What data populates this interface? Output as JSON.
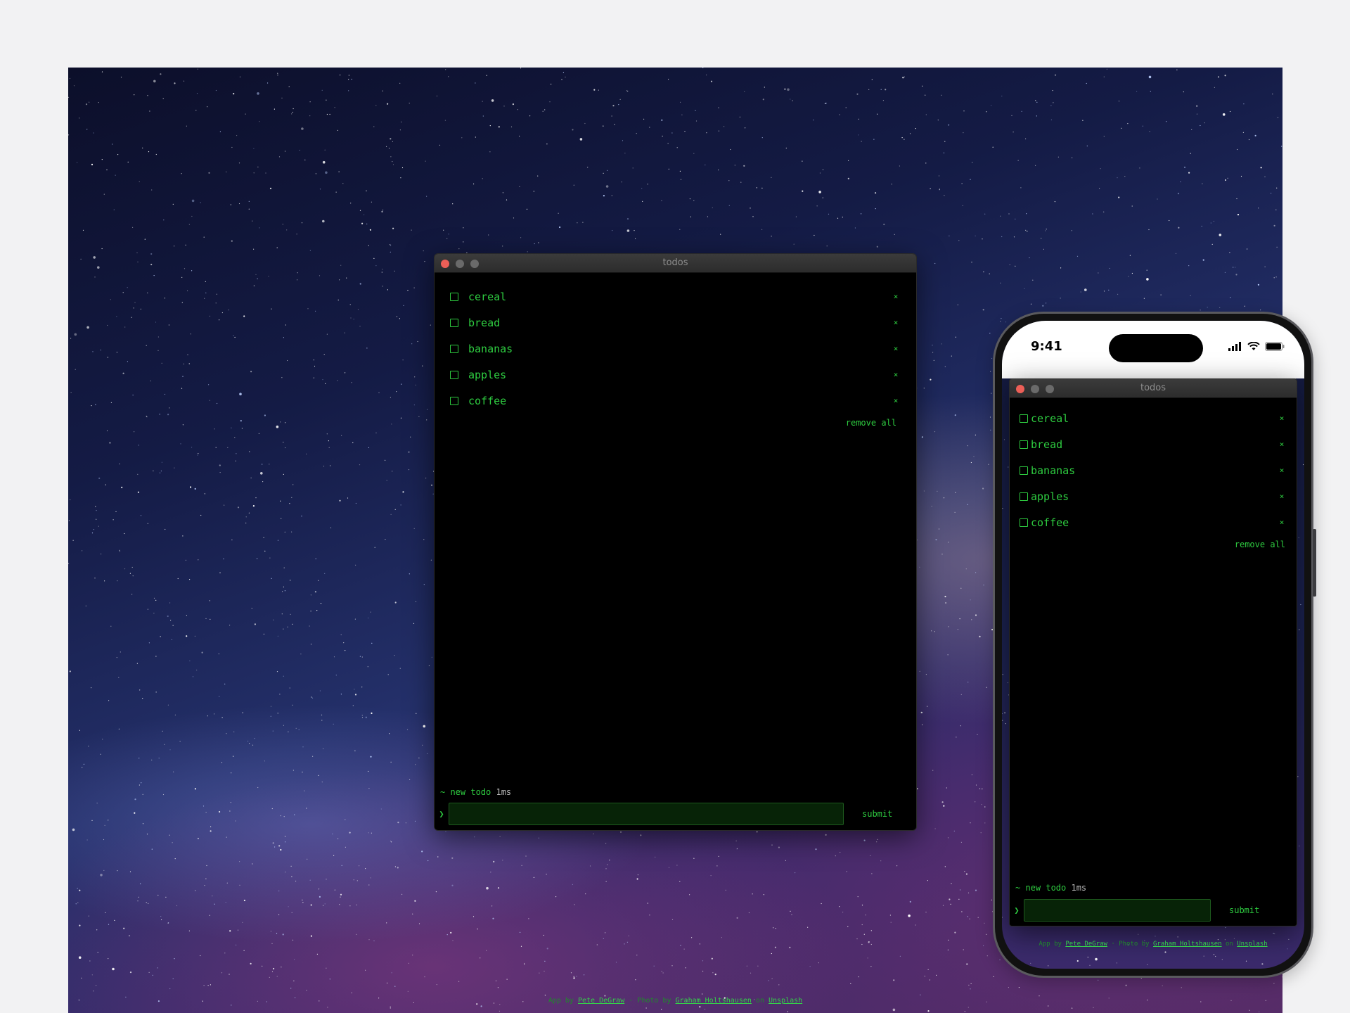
{
  "window": {
    "title": "todos"
  },
  "todos": [
    {
      "label": "cereal",
      "delete_glyph": "×"
    },
    {
      "label": "bread",
      "delete_glyph": "×"
    },
    {
      "label": "bananas",
      "delete_glyph": "×"
    },
    {
      "label": "apples",
      "delete_glyph": "×"
    },
    {
      "label": "coffee",
      "delete_glyph": "×"
    }
  ],
  "remove_all_label": "remove all",
  "status": {
    "prefix": "~ new todo",
    "timing": "1ms"
  },
  "input": {
    "prompt": "❯",
    "value": "",
    "placeholder": ""
  },
  "submit_label": "submit",
  "credits": {
    "app_by": "App by",
    "app_author": "Pete DeGraw",
    "separator": "·",
    "photo_by": "Photo by",
    "photographer": "Graham Holtshausen",
    "on": "on",
    "source": "Unsplash"
  },
  "phone": {
    "time": "9:41"
  },
  "colors": {
    "accent_green": "#2ecc40",
    "input_bg": "#072307",
    "close_red": "#ec5f57",
    "page_bg": "#f2f2f3"
  }
}
